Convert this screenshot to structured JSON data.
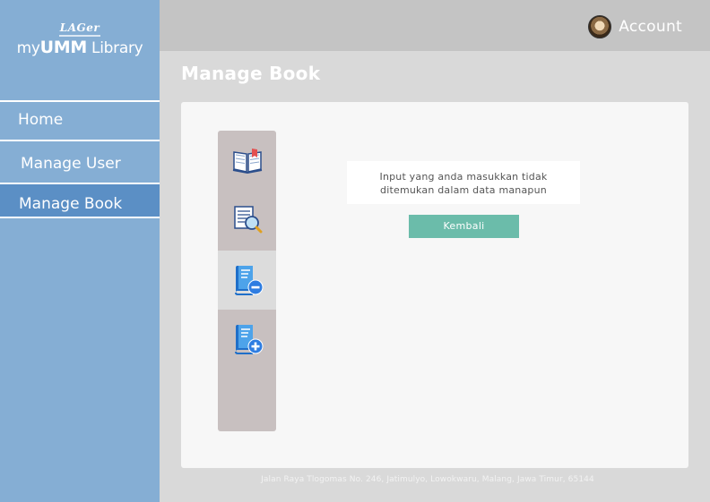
{
  "logo": {
    "top_text": "LAGer",
    "main_prefix": "my",
    "main_bold": "UMM",
    "main_suffix": " Library"
  },
  "nav": {
    "items": [
      {
        "label": "Home",
        "active": false
      },
      {
        "label": "Manage User",
        "active": false
      },
      {
        "label": "Manage Book",
        "active": true
      }
    ]
  },
  "header": {
    "account_label": "Account",
    "avatar_icon": "user-avatar"
  },
  "page": {
    "title": "Manage Book"
  },
  "tools": [
    {
      "icon": "open-book-icon",
      "selected": false
    },
    {
      "icon": "search-book-icon",
      "selected": false
    },
    {
      "icon": "remove-book-icon",
      "selected": true
    },
    {
      "icon": "add-book-icon",
      "selected": false
    }
  ],
  "message": {
    "line1": "Input yang anda masukkan tidak",
    "line2": "ditemukan dalam data manapun"
  },
  "back_button": {
    "label": "Kembali"
  },
  "footer": {
    "address": "Jalan Raya Tlogomas No. 246, Jatimulyo, Lowokwaru, Malang, Jawa Timur, 65144"
  },
  "colors": {
    "sidebar": "#85aed4",
    "active_nav": "#5b8fc5",
    "topbar": "#c4c4c4",
    "button": "#6bbcaa",
    "toolbar": "#c8c0c0"
  }
}
